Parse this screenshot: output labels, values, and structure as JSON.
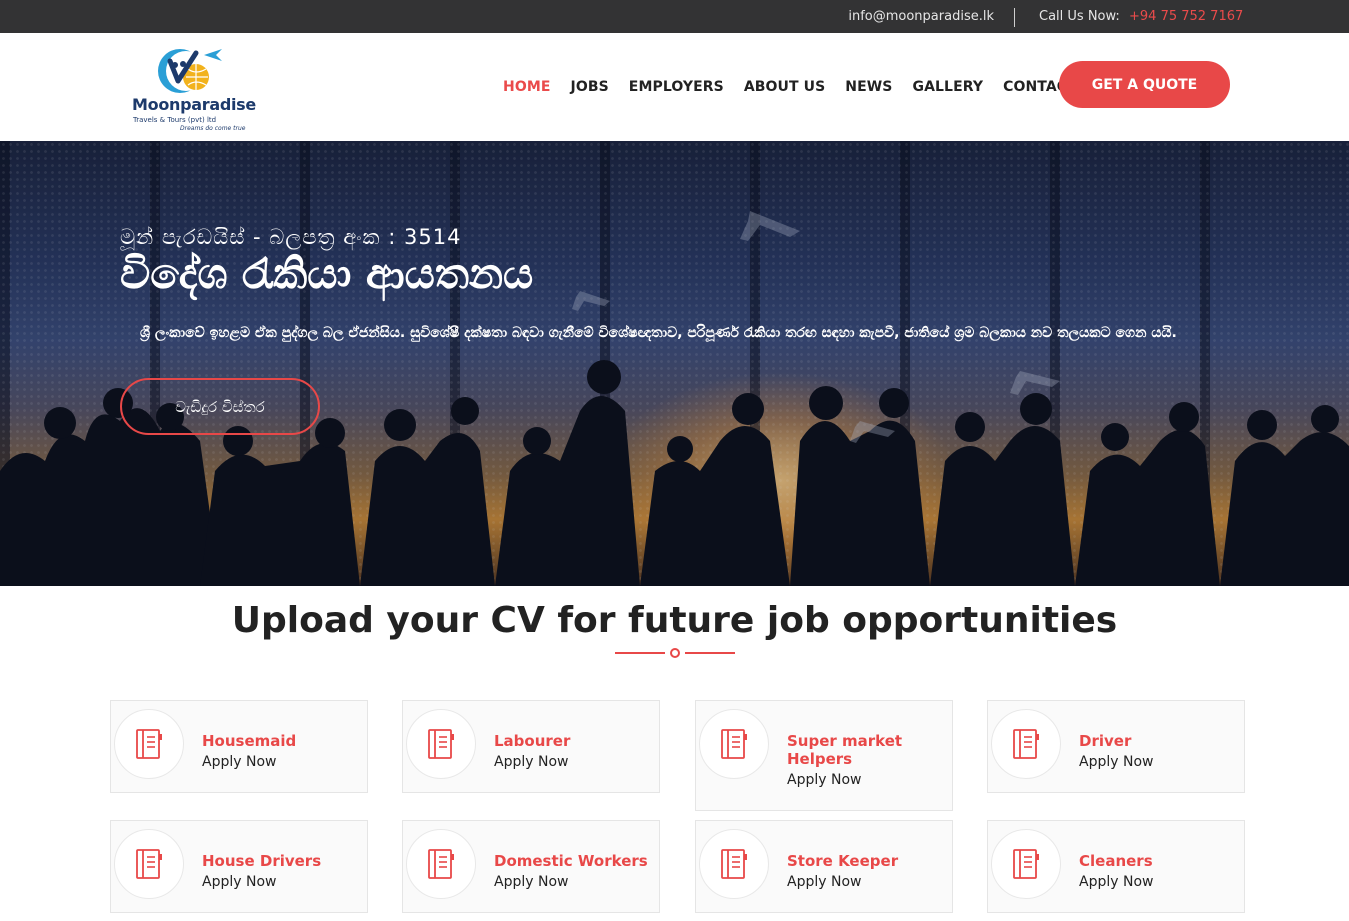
{
  "topbar": {
    "email": "info@moonparadise.lk",
    "call_label": "Call Us Now:",
    "call_number": "+94 75 752 7167"
  },
  "logo": {
    "brand": "Moonparadise",
    "subtitle": "Travels & Tours (pvt) ltd",
    "tagline": "Dreams do come true"
  },
  "nav": {
    "items": [
      "HOME",
      "JOBS",
      "EMPLOYERS",
      "ABOUT US",
      "NEWS",
      "GALLERY",
      "CONTACT"
    ],
    "active": "HOME"
  },
  "quote_button": "GET A QUOTE",
  "hero": {
    "kicker": "මූන් පැරඩයිස් - බලපත්‍ර අංක : 3514",
    "title": "විදේශ රැකියා ආයතනය",
    "description": "ශ්‍රී ලංකාවේ ඉහළම ඒක පුද්ගල බල ඒජන්සිය. සුවිශේෂී දක්ෂතා බඳවා ගැනීමේ විශේෂඥතාව, පරිපූර්ණ රැකියා තරඟ සඳහා කැපවී, ජාතියේ ශ්‍රම බලකාය නව තලයකට ගෙන යයි.",
    "button": "වැඩිදුර විස්තර"
  },
  "section": {
    "title": "Upload your CV for future job opportunities"
  },
  "jobs": [
    {
      "title": "Housemaid",
      "action": "Apply Now"
    },
    {
      "title": "Labourer",
      "action": "Apply Now"
    },
    {
      "title": "Super market Helpers",
      "action": "Apply Now"
    },
    {
      "title": "Driver",
      "action": "Apply Now"
    },
    {
      "title": "House Drivers",
      "action": "Apply Now"
    },
    {
      "title": "Domestic Workers",
      "action": "Apply Now"
    },
    {
      "title": "Store Keeper",
      "action": "Apply Now"
    },
    {
      "title": "Cleaners",
      "action": "Apply Now"
    }
  ],
  "colors": {
    "accent": "#e84848",
    "topbar": "#333334",
    "text": "#222222"
  },
  "icons": {
    "job_card": "notebook-icon"
  }
}
